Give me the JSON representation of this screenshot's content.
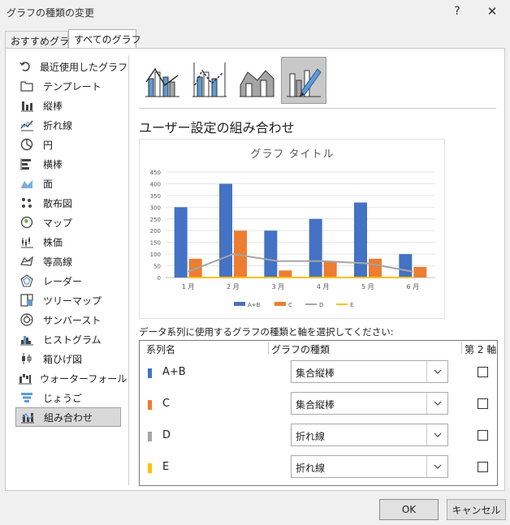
{
  "window": {
    "title": "グラフの種類の変更",
    "help_label": "?",
    "close_label": "✕"
  },
  "tabs": [
    {
      "label": "おすすめグラフ"
    },
    {
      "label": "すべてのグラフ"
    }
  ],
  "sidebar": {
    "items": [
      {
        "label": "最近使用したグラフ",
        "icon": "recent-icon"
      },
      {
        "label": "テンプレート",
        "icon": "folder-icon"
      },
      {
        "label": "縦棒",
        "icon": "column-chart-icon"
      },
      {
        "label": "折れ線",
        "icon": "line-chart-icon"
      },
      {
        "label": "円",
        "icon": "pie-chart-icon"
      },
      {
        "label": "横棒",
        "icon": "bar-chart-icon"
      },
      {
        "label": "面",
        "icon": "area-chart-icon"
      },
      {
        "label": "散布図",
        "icon": "scatter-chart-icon"
      },
      {
        "label": "マップ",
        "icon": "map-chart-icon"
      },
      {
        "label": "株価",
        "icon": "stock-chart-icon"
      },
      {
        "label": "等高線",
        "icon": "surface-chart-icon"
      },
      {
        "label": "レーダー",
        "icon": "radar-chart-icon"
      },
      {
        "label": "ツリーマップ",
        "icon": "treemap-icon"
      },
      {
        "label": "サンバースト",
        "icon": "sunburst-icon"
      },
      {
        "label": "ヒストグラム",
        "icon": "histogram-icon"
      },
      {
        "label": "箱ひげ図",
        "icon": "box-whisker-icon"
      },
      {
        "label": "ウォーターフォール",
        "icon": "waterfall-icon"
      },
      {
        "label": "じょうご",
        "icon": "funnel-icon"
      },
      {
        "label": "組み合わせ",
        "icon": "combo-chart-icon"
      }
    ],
    "selected_index": 18
  },
  "combo": {
    "heading": "ユーザー設定の組み合わせ",
    "selected_thumb": 3,
    "thumb_icons": [
      "clustered-column-line-icon",
      "clustered-column-line-secondary-icon",
      "stacked-area-column-icon",
      "custom-combo-icon"
    ]
  },
  "chart_data": {
    "type": "bar",
    "title": "グラフ タイトル",
    "categories": [
      "1 月",
      "2 月",
      "3 月",
      "4 月",
      "5 月",
      "6 月"
    ],
    "y_ticks": [
      "0",
      "50",
      "100",
      "150",
      "200",
      "250",
      "300",
      "350",
      "400",
      "450"
    ],
    "ylim": [
      0,
      450
    ],
    "series": [
      {
        "name": "A+B",
        "type": "bar",
        "color": "#4472c4",
        "values": [
          300,
          400,
          200,
          250,
          320,
          100
        ]
      },
      {
        "name": "C",
        "type": "bar",
        "color": "#ed7d31",
        "values": [
          80,
          200,
          30,
          70,
          80,
          45
        ]
      },
      {
        "name": "D",
        "type": "line",
        "color": "#a5a5a5",
        "values": [
          25,
          100,
          70,
          70,
          60,
          25
        ]
      },
      {
        "name": "E",
        "type": "line",
        "color": "#ffc000",
        "values": [
          0,
          0,
          0,
          0,
          0,
          0
        ]
      }
    ],
    "legend_position": "bottom",
    "grid": true
  },
  "series_config": {
    "instruction": "データ系列に使用するグラフの種類と軸を選択してください:",
    "headers": {
      "name": "系列名",
      "type": "グラフの種類",
      "secondary": "第 2 軸"
    },
    "rows": [
      {
        "name": "A+B",
        "color": "#4472c4",
        "chart_type": "集合縦棒",
        "secondary": false
      },
      {
        "name": "C",
        "color": "#ed7d31",
        "chart_type": "集合縦棒",
        "secondary": false
      },
      {
        "name": "D",
        "color": "#a5a5a5",
        "chart_type": "折れ線",
        "secondary": false
      },
      {
        "name": "E",
        "color": "#ffc000",
        "chart_type": "折れ線",
        "secondary": false
      }
    ]
  },
  "buttons": {
    "ok": "OK",
    "cancel": "キャンセル"
  }
}
